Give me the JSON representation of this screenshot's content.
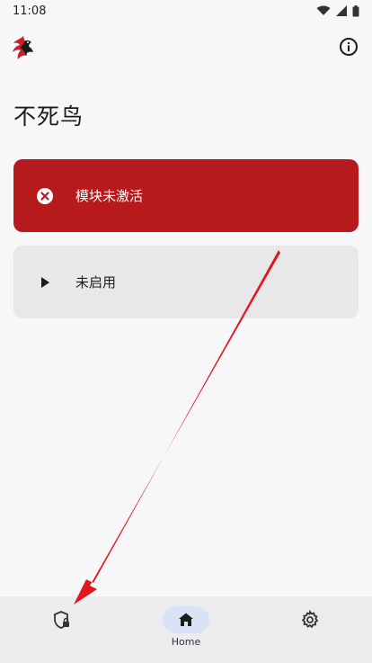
{
  "statusbar": {
    "time": "11:08"
  },
  "header": {
    "title": "不死鸟"
  },
  "cards": {
    "status": {
      "label": "模块未激活"
    },
    "action": {
      "label": "未启用"
    }
  },
  "nav": {
    "items": [
      {
        "icon": "shield-lock-icon",
        "label": ""
      },
      {
        "icon": "home-icon",
        "label": "Home"
      },
      {
        "icon": "gear-icon",
        "label": ""
      }
    ]
  },
  "colors": {
    "status_card": "#b71a1d",
    "action_card": "#e8e7ea",
    "nav_active": "#d8e3f5",
    "arrow": "#e0181e"
  }
}
